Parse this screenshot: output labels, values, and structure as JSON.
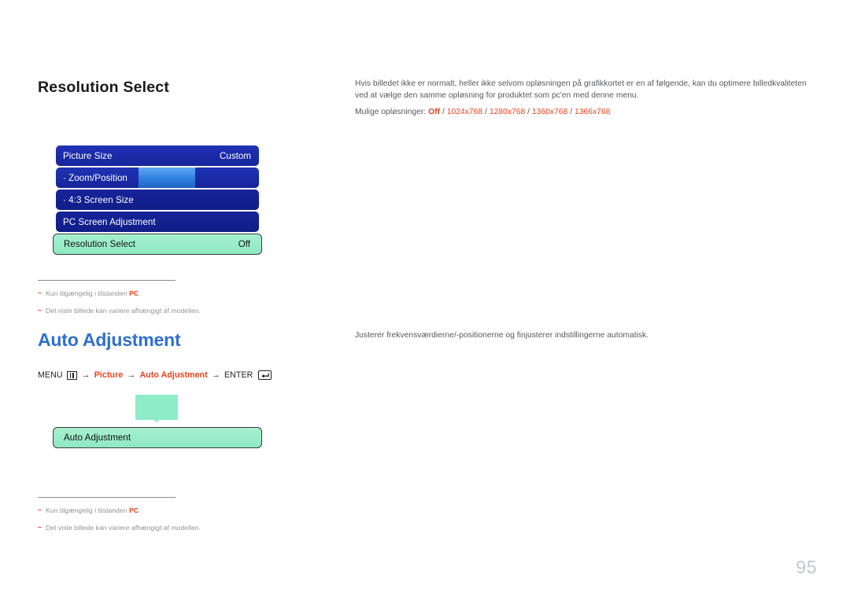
{
  "page": {
    "number": "95"
  },
  "sections": [
    {
      "id": "resolution-select",
      "heading": "Resolution Select",
      "heading_style": "black",
      "description_lines": [
        "Hvis billedet ikke er normalt, heller ikke selvom opløsningen på grafikkortet er en af følgende, kan du optimere billedkvaliteten",
        "ved at vælge den samme opløsning for produktet som pc'en med denne menu."
      ],
      "options_label": "Mulige opløsninger:",
      "options": [
        "Off",
        "1024x768",
        "1280x768",
        "1360x768",
        "1366x768"
      ],
      "options_separator": "/",
      "osd": {
        "rows": [
          {
            "label": "Picture Size",
            "value": "Custom",
            "style": "blue-bright",
            "slider": false,
            "selected": false
          },
          {
            "label": "· Zoom/Position",
            "value": "",
            "style": "blue-bright",
            "slider": true,
            "selected": false
          },
          {
            "label": "· 4:3 Screen Size",
            "value": "",
            "style": "blue-dark",
            "slider": false,
            "selected": false
          },
          {
            "label": "PC Screen Adjustment",
            "value": "",
            "style": "blue-dark",
            "slider": false,
            "selected": false
          },
          {
            "label": "Resolution Select",
            "value": "Off",
            "style": "selected",
            "slider": false,
            "selected": true
          }
        ],
        "bubble": false
      },
      "footnotes": [
        {
          "dash": "–",
          "text_before": "Kun tilgængelig i tilstanden ",
          "highlight": "PC",
          "text_after": "."
        },
        {
          "dash": "–",
          "text_before": "Det viste billede kan variere afhængigt af modellen.",
          "highlight": "",
          "text_after": ""
        }
      ]
    },
    {
      "id": "auto-adjustment",
      "heading": "Auto Adjustment",
      "heading_style": "blue",
      "menu_path": {
        "menu_label": "MENU",
        "menu_icon": "menu-bars-icon",
        "arrow": "→",
        "step1": "Picture",
        "step2": "Auto Adjustment",
        "enter_label": "ENTER",
        "enter_icon": "enter-key-icon"
      },
      "description_lines": [
        "Justerer frekvensværdierne/-positionerne og finjusterer indstillingerne automatisk."
      ],
      "osd": {
        "rows": [
          {
            "label": "Auto Adjustment",
            "value": "",
            "style": "selected",
            "slider": false,
            "selected": true
          }
        ],
        "bubble": true
      },
      "footnotes": [
        {
          "dash": "–",
          "text_before": "Kun tilgængelig i tilstanden ",
          "highlight": "PC",
          "text_after": "."
        },
        {
          "dash": "–",
          "text_before": "Det viste billede kan variere afhængigt af modellen.",
          "highlight": "",
          "text_after": ""
        }
      ]
    }
  ],
  "colors": {
    "accent_red": "#e8421c",
    "heading_blue": "#2e6fd0",
    "osd_blue_bright": "#1c2ea8",
    "osd_blue_dark": "#16249a",
    "osd_selected_mint": "#8fecc9",
    "slider_blue": "#2f7fe0",
    "body_gray": "#56585b",
    "footnote_gray": "#8f9295",
    "page_number_gray": "#c3c7cb"
  }
}
